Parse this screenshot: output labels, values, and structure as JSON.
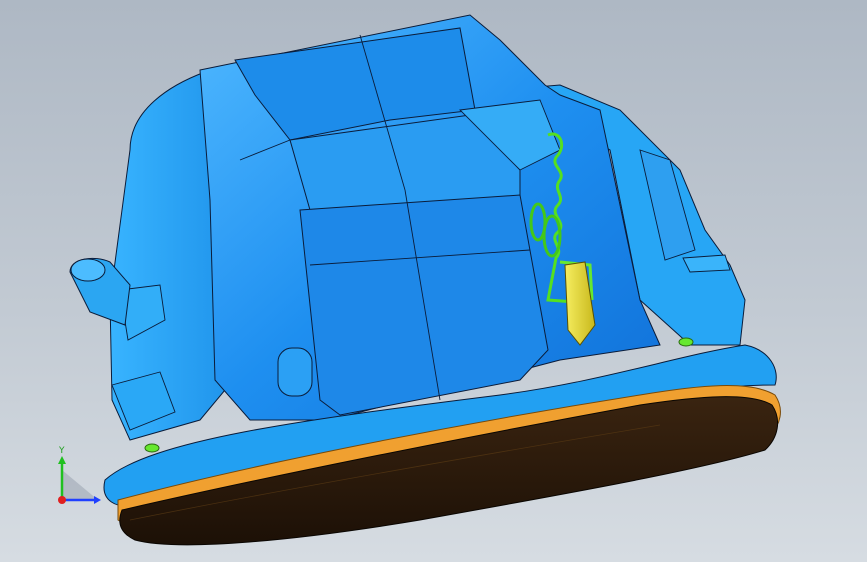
{
  "viewport": {
    "background_top": "#aeb8c4",
    "background_bottom": "#d6dce2"
  },
  "model": {
    "body_color": "#1e9bf0",
    "body_highlight": "#5bc2ff",
    "body_shadow": "#0c6fd1",
    "edge_color": "#0a1c3a",
    "spring_color": "#55e020",
    "cam_color": "#f2e640",
    "rim_color": "#f0a030",
    "lens_color": "#2a1a08"
  },
  "triad": {
    "y_label": "Y",
    "x_color": "#e02020",
    "y_color": "#20c020",
    "z_color": "#2040ff",
    "icons": [
      "x-axis-icon",
      "y-axis-icon",
      "z-axis-icon",
      "origin-icon"
    ]
  }
}
